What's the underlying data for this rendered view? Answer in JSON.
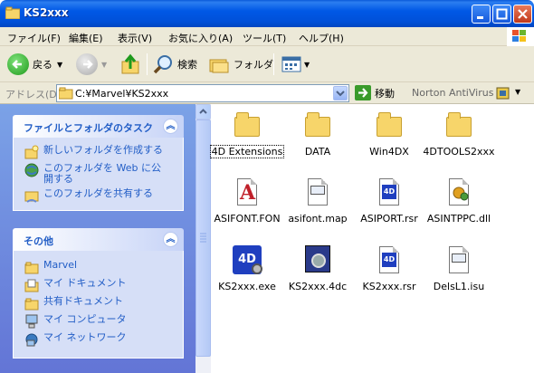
{
  "window": {
    "title": "KS2xxx"
  },
  "menu": [
    "ファイル(F)",
    "編集(E)",
    "表示(V)",
    "お気に入り(A)",
    "ツール(T)",
    "ヘルプ(H)"
  ],
  "toolbar": {
    "back_label": "戻る",
    "search_label": "検索",
    "folders_label": "フォルダ"
  },
  "address": {
    "label": "アドレス(D)",
    "value": "C:¥Marvel¥KS2xxx",
    "go_label": "移動",
    "norton_label": "Norton AntiVirus"
  },
  "tasks": {
    "title": "ファイルとフォルダのタスク",
    "items": [
      "新しいフォルダを作成する",
      "このフォルダを Web に公開する",
      "このフォルダを共有する"
    ]
  },
  "other": {
    "title": "その他",
    "items": [
      "Marvel",
      "マイ ドキュメント",
      "共有ドキュメント",
      "マイ コンピュータ",
      "マイ ネットワーク"
    ]
  },
  "files": [
    {
      "name": "4D Extensions",
      "icon": "folder-icon"
    },
    {
      "name": "DATA",
      "icon": "folder-icon"
    },
    {
      "name": "Win4DX",
      "icon": "folder-icon"
    },
    {
      "name": "4DTOOLS2xxx",
      "icon": "folder-icon"
    },
    {
      "name": "ASIFONT.FON",
      "icon": "font-file-icon"
    },
    {
      "name": "asifont.map",
      "icon": "map-file-icon"
    },
    {
      "name": "ASIPORT.rsr",
      "icon": "4d-resource-icon"
    },
    {
      "name": "ASINTPPC.dll",
      "icon": "dll-file-icon"
    },
    {
      "name": "KS2xxx.exe",
      "icon": "4d-app-icon"
    },
    {
      "name": "KS2xxx.4dc",
      "icon": "4d-compiled-icon"
    },
    {
      "name": "KS2xxx.rsr",
      "icon": "4d-resource-icon"
    },
    {
      "name": "DelsL1.isu",
      "icon": "isu-file-icon"
    }
  ]
}
